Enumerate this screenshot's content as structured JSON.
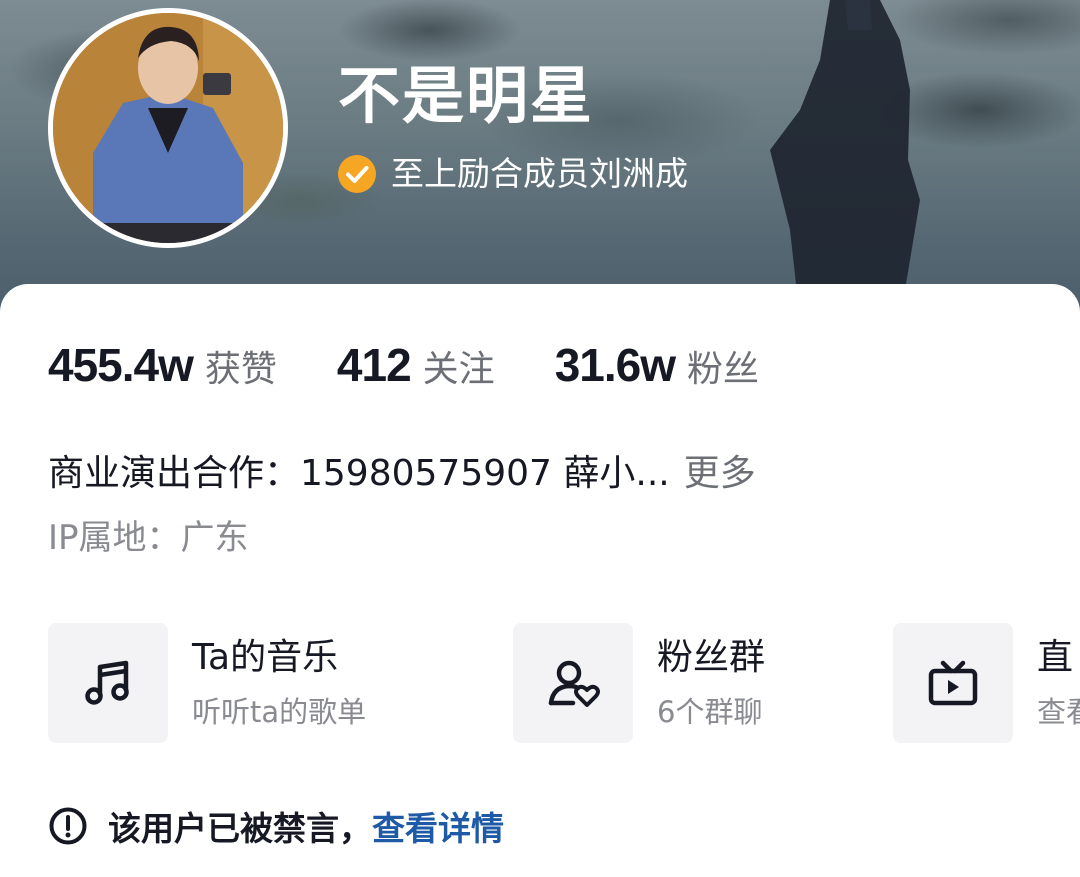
{
  "profile": {
    "nickname": "不是明星",
    "verification": "至上励合成员刘洲成",
    "verified_badge_color": "#f5a623",
    "avatar": "avatar-photo"
  },
  "stats": [
    {
      "value": "455.4w",
      "label": "获赞"
    },
    {
      "value": "412",
      "label": "关注"
    },
    {
      "value": "31.6w",
      "label": "粉丝"
    }
  ],
  "bio": {
    "text": "商业演出合作：15980575907 薛小...",
    "more_label": "更多"
  },
  "ip_location": "IP属地：广东",
  "features": [
    {
      "icon": "music-note-icon",
      "title": "Ta的音乐",
      "subtitle": "听听ta的歌单"
    },
    {
      "icon": "fan-group-icon",
      "title": "粉丝群",
      "subtitle": "6个群聊"
    },
    {
      "icon": "live-tv-icon",
      "title": "直",
      "subtitle": "查看"
    }
  ],
  "notice": {
    "icon": "exclamation-circle-icon",
    "text": "该用户已被禁言，",
    "link_label": "查看详情",
    "link_color": "#1f5aa6"
  }
}
